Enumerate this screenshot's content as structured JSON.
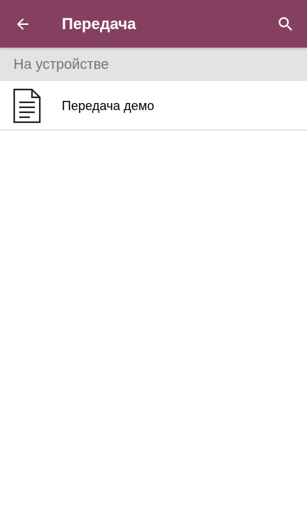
{
  "toolbar": {
    "title": "Передача",
    "back_icon": "arrow-back-icon",
    "search_icon": "search-icon",
    "background_color": "#86405f"
  },
  "section": {
    "header": "На устройстве"
  },
  "documents": [
    {
      "label": "Передача демо",
      "icon": "document-icon"
    }
  ]
}
